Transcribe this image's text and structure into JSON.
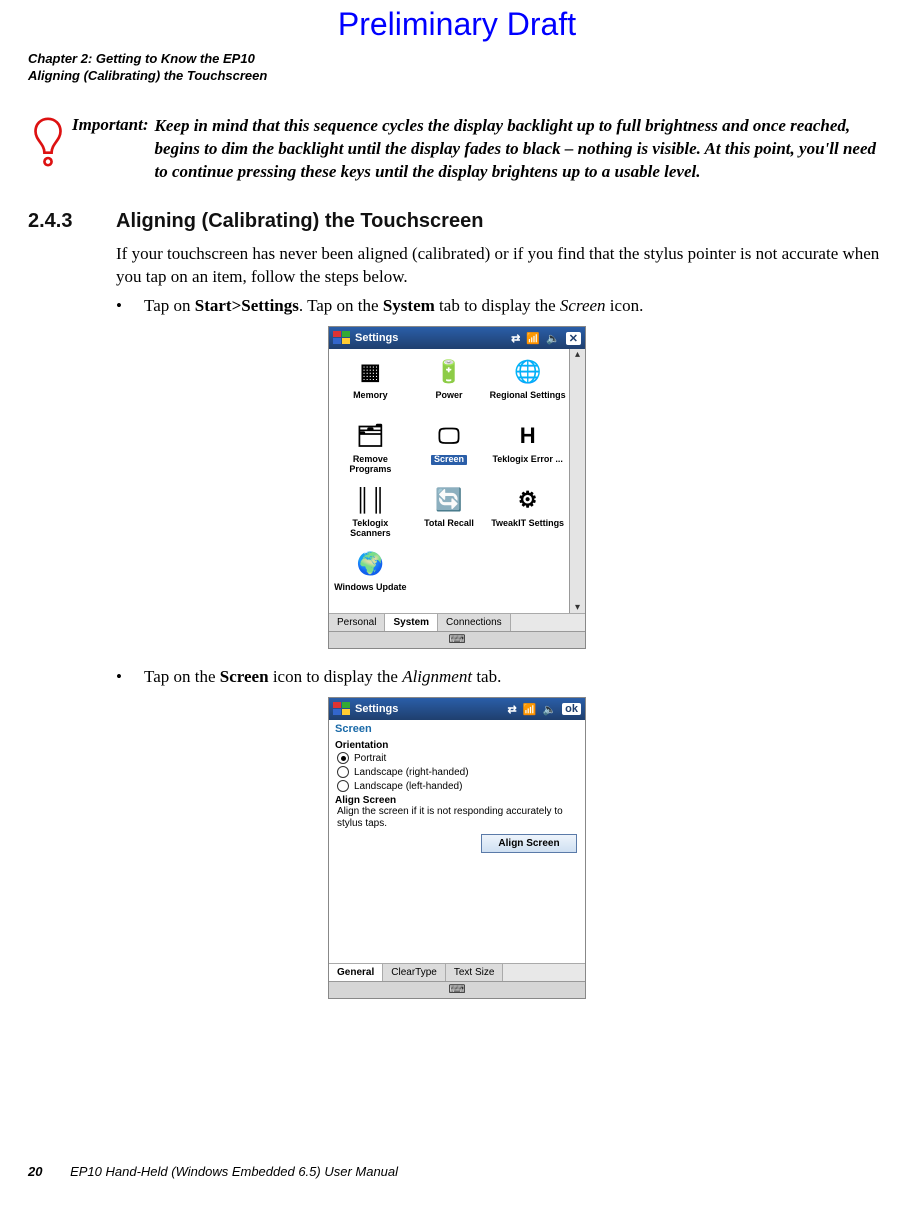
{
  "watermark": "Preliminary Draft",
  "header": {
    "chapter_line": "Chapter 2: Getting to Know the EP10",
    "section_line": "Aligning (Calibrating) the Touchscreen"
  },
  "important": {
    "label": "Important:",
    "text": "Keep in mind that this sequence cycles the display backlight up to full brightness and once reached, begins to dim the backlight until the display fades to black – nothing is visible. At this point, you'll need to continue pressing these keys until the display brightens up to a usable level."
  },
  "section": {
    "number": "2.4.3",
    "title": "Aligning (Calibrating) the Touchscreen"
  },
  "para_intro": "If your touchscreen has never been aligned (calibrated) or if you find that the stylus pointer is not accurate when you tap on an item, follow the steps below.",
  "bullet1": {
    "t1": "Tap on ",
    "b1": "Start>Settings",
    "t2": ". Tap on the ",
    "b2": "System",
    "t3": " tab to display the ",
    "i1": "Screen",
    "t4": " icon."
  },
  "bullet2": {
    "t1": "Tap on the ",
    "b1": "Screen",
    "t2": " icon to display the ",
    "i1": "Alignment",
    "t3": " tab."
  },
  "pda1": {
    "title": "Settings",
    "grid": [
      {
        "label": "Memory",
        "icon": "▦"
      },
      {
        "label": "Power",
        "icon": "🔋"
      },
      {
        "label": "Regional Settings",
        "icon": "🌐"
      },
      {
        "label": "Remove Programs",
        "icon": "🗂"
      },
      {
        "label": "Screen",
        "icon": "🖵",
        "selected": true
      },
      {
        "label": "Teklogix Error ...",
        "icon": "H"
      },
      {
        "label": "Teklogix Scanners",
        "icon": "║║"
      },
      {
        "label": "Total Recall",
        "icon": "🔄"
      },
      {
        "label": "TweakIT Settings",
        "icon": "⚙"
      },
      {
        "label": "Windows Update",
        "icon": "🌍"
      }
    ],
    "tabs": [
      "Personal",
      "System",
      "Connections"
    ],
    "active_tab": "System"
  },
  "pda2": {
    "title": "Settings",
    "subtitle": "Screen",
    "orientation_label": "Orientation",
    "orientation_options": [
      "Portrait",
      "Landscape (right-handed)",
      "Landscape (left-handed)"
    ],
    "orientation_selected": "Portrait",
    "align_label": "Align Screen",
    "align_desc": "Align the screen if it is not responding accurately to stylus taps.",
    "align_button": "Align Screen",
    "tabs": [
      "General",
      "ClearType",
      "Text Size"
    ],
    "active_tab": "General"
  },
  "footer": {
    "page": "20",
    "title": "EP10 Hand-Held (Windows Embedded 6.5) User Manual"
  }
}
